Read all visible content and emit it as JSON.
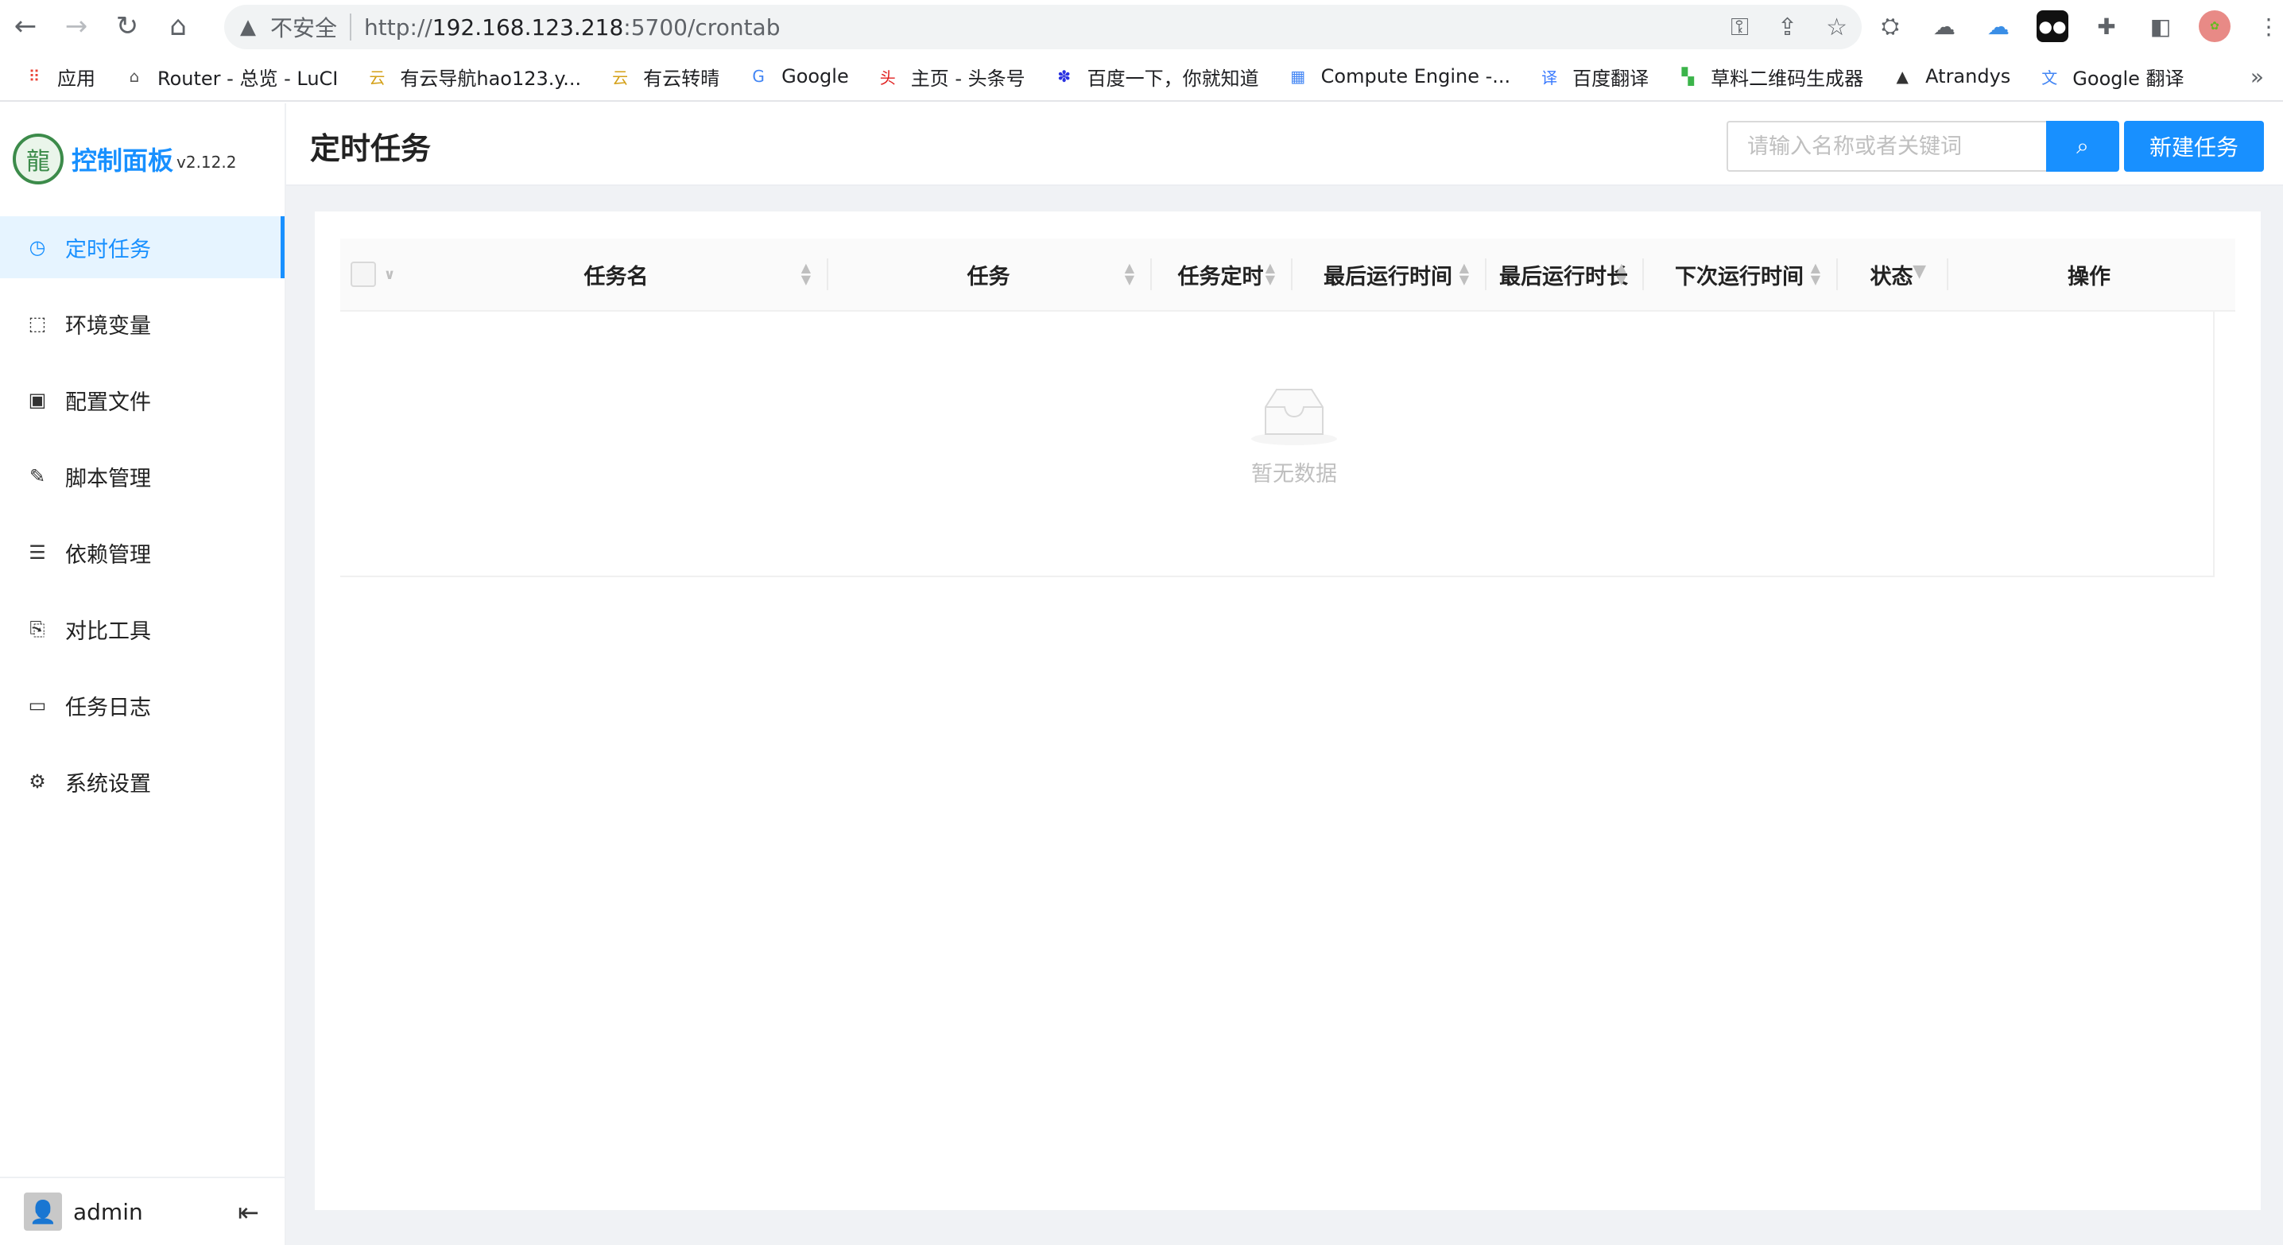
{
  "browser": {
    "security_label": "不安全",
    "url_prefix": "http://",
    "url_host": "192.168.123.218",
    "url_rest": ":5700/crontab",
    "bookmarks": [
      {
        "label": "应用",
        "icon": "apps-grid-icon",
        "color": "#ea4335"
      },
      {
        "label": "Router - 总览 - LuCI",
        "icon": "router-icon",
        "color": "#555555"
      },
      {
        "label": "有云导航hao123.y...",
        "icon": "youyun-icon",
        "color": "#d4a017"
      },
      {
        "label": "有云转晴",
        "icon": "youyun-icon",
        "color": "#d4a017"
      },
      {
        "label": "Google",
        "icon": "google-icon",
        "color": "#4285f4"
      },
      {
        "label": "主页 - 头条号",
        "icon": "toutiao-icon",
        "color": "#e02020"
      },
      {
        "label": "百度一下，你就知道",
        "icon": "baidu-paw-icon",
        "color": "#2932e1"
      },
      {
        "label": "Compute Engine -...",
        "icon": "chip-icon",
        "color": "#4285f4"
      },
      {
        "label": "百度翻译",
        "icon": "translate-icon",
        "color": "#3a7afe"
      },
      {
        "label": "草料二维码生成器",
        "icon": "qrcode-icon",
        "color": "#3bb44a"
      },
      {
        "label": "Atrandys",
        "icon": "atrandys-icon",
        "color": "#333333"
      },
      {
        "label": "Google 翻译",
        "icon": "google-translate-icon",
        "color": "#4285f4"
      }
    ],
    "more_label": "»"
  },
  "sidebar": {
    "title": "控制面板",
    "version": "v2.12.2",
    "items": [
      {
        "label": "定时任务",
        "icon": "clock-icon",
        "glyph": "◷",
        "active": true
      },
      {
        "label": "环境变量",
        "icon": "variable-icon",
        "glyph": "⬚",
        "active": false
      },
      {
        "label": "配置文件",
        "icon": "config-icon",
        "glyph": "▣",
        "active": false
      },
      {
        "label": "脚本管理",
        "icon": "edit-icon",
        "glyph": "✎",
        "active": false
      },
      {
        "label": "依赖管理",
        "icon": "dependency-icon",
        "glyph": "☰",
        "active": false
      },
      {
        "label": "对比工具",
        "icon": "diff-icon",
        "glyph": "⎘",
        "active": false
      },
      {
        "label": "任务日志",
        "icon": "folder-icon",
        "glyph": "▭",
        "active": false
      },
      {
        "label": "系统设置",
        "icon": "gear-icon",
        "glyph": "⚙",
        "active": false
      }
    ],
    "user": "admin"
  },
  "header": {
    "title": "定时任务",
    "search_placeholder": "请输入名称或者关键词",
    "new_button": "新建任务"
  },
  "table": {
    "columns": [
      {
        "label": "任务名",
        "sortable": true
      },
      {
        "label": "任务",
        "sortable": true
      },
      {
        "label": "任务定时",
        "sortable": true
      },
      {
        "label": "最后运行时间",
        "sortable": true
      },
      {
        "label": "最后运行时长",
        "sortable": true
      },
      {
        "label": "下次运行时间",
        "sortable": true
      },
      {
        "label": "状态",
        "filterable": true
      },
      {
        "label": "操作"
      }
    ],
    "rows": [],
    "empty_text": "暂无数据"
  },
  "colors": {
    "accent": "#1890ff",
    "active_bg": "#e6f4ff",
    "content_bg": "#f0f2f5"
  }
}
